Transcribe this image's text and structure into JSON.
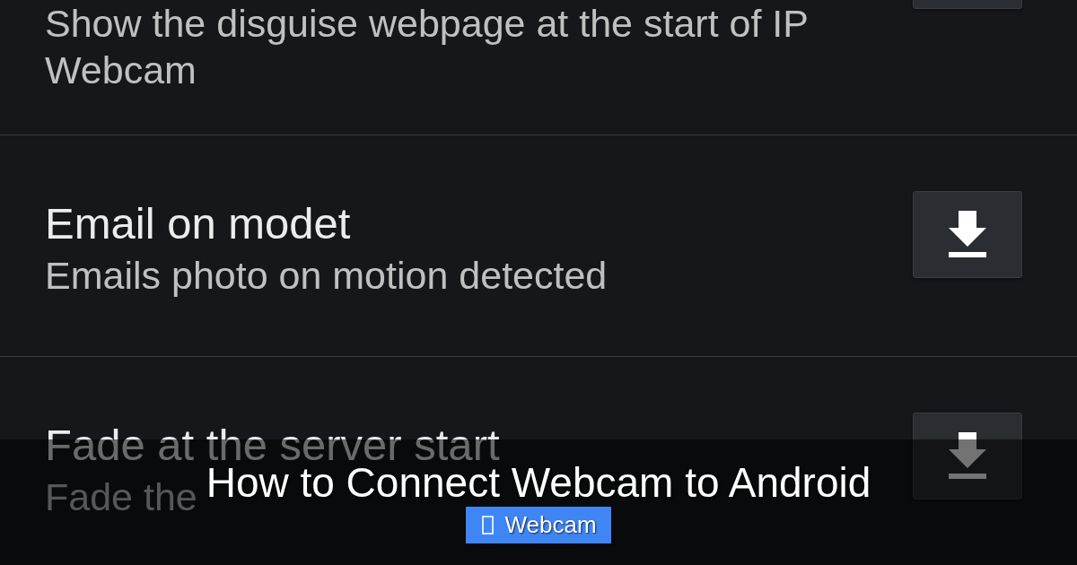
{
  "settings_list": [
    {
      "kind": "partial",
      "subtitle": "Show the disguise webpage at the start of IP Webcam"
    },
    {
      "kind": "full",
      "title": "Email on modet",
      "subtitle": "Emails photo on motion detected"
    },
    {
      "kind": "full",
      "title": "Fade at the server start",
      "subtitle": "Fade the"
    }
  ],
  "banner": {
    "title": "How to Connect Webcam to Android",
    "tag": {
      "label": "Webcam"
    }
  }
}
